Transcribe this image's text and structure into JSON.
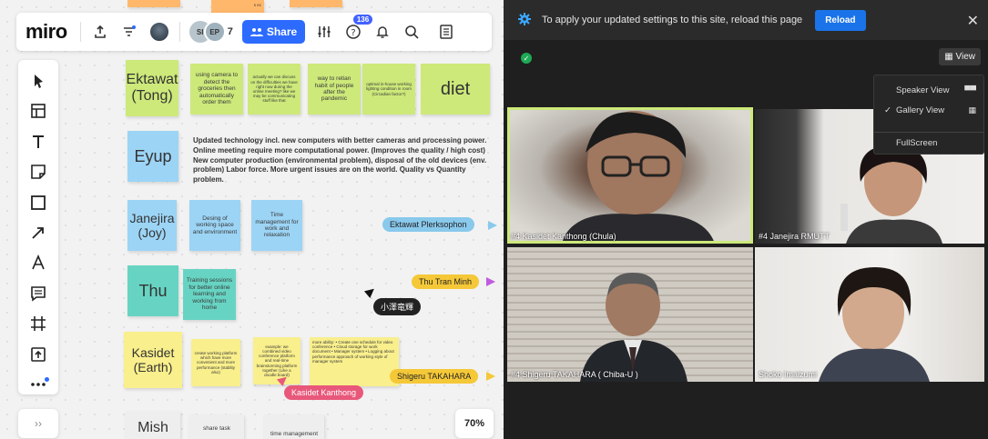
{
  "miro": {
    "logo": "miro",
    "collab": {
      "av1": "SI",
      "av2": "EP",
      "count": "7"
    },
    "share_label": "Share",
    "notif_badge": "136",
    "zoom": "70%",
    "expand_label": "››",
    "tools": [
      "select",
      "template",
      "text",
      "sticky-note",
      "shape",
      "connector",
      "pen",
      "comment",
      "frame",
      "upload",
      "more"
    ],
    "rows": {
      "ektawat": "Ektawat (Tong)",
      "eyup": "Eyup",
      "janejira": "Janejira (Joy)",
      "thu": "Thu",
      "kasidet": "Kasidet (Earth)",
      "mish": "Mish"
    },
    "notes": {
      "n1": "using camera to detect the groceries then automatically order them",
      "n2": "actually we can discuss on the difficulties we have right now during the online meeting? like we may be communicating stuff like that",
      "n3": "way to retian habit of people after the pandemic",
      "n4": "optimal in-house working lighting condition in room (Circadian factor?)",
      "n5": "diet",
      "jn1": "Desing of working space and environment",
      "jn2": "Time management for work and relaxation",
      "tn1": "Training sessions for better online learning and working from home",
      "kn1": "create working platform which have more convenient and more performance (stablity also)",
      "kn2": "example: we combined video conference platform and real-time brainstorming platform together (Like a doodle board)",
      "kn3": "more ability: • Create one schedule for video conference • Cloud storage for work document • Manager system • Logging about performance approach of working style of manager system",
      "mn1": "share task",
      "mn2": "time management"
    },
    "eyup_text": "Updated technology incl. new computers with better cameras and processing power. Online meeting require more computational power. (Improves the quality / high cost) New computer production (environmental problem), disposal of the old devices (env. problem) Labor force. More urgent issues are on the world. Quality vs Quantity problem.",
    "cursors": {
      "c1": "Ektawat Plerksophon",
      "c2": "Thu Tran Minh",
      "c3": "小澤竜輝",
      "c4": "Shigeru TAKAHARA",
      "c5": "Kasidet Kanthong"
    },
    "topnote": "s ec"
  },
  "meet": {
    "banner_text": "To apply your updated settings to this site, reload this page",
    "reload_label": "Reload",
    "view_label": "View",
    "menu": {
      "speaker": "Speaker View",
      "gallery": "Gallery View",
      "fullscreen": "FullScreen",
      "check": "✓"
    },
    "tiles": {
      "t1": "#4 Kasidet Kanthong (Chula)",
      "t2": "#4 Janejira RMUTT",
      "t3": "#4 Shigeru TAKAHARA ( Chiba-U )",
      "t4": "Shoko Imaizumi"
    }
  },
  "colors": {
    "miro_blue": "#2d6bff",
    "sticky_green": "#cde97a",
    "sticky_blue": "#9cd4f5",
    "sticky_teal": "#67d4c3",
    "sticky_yellow": "#f9ef8c",
    "active_speaker": "#cde97a",
    "reload_blue": "#1a73e8"
  }
}
